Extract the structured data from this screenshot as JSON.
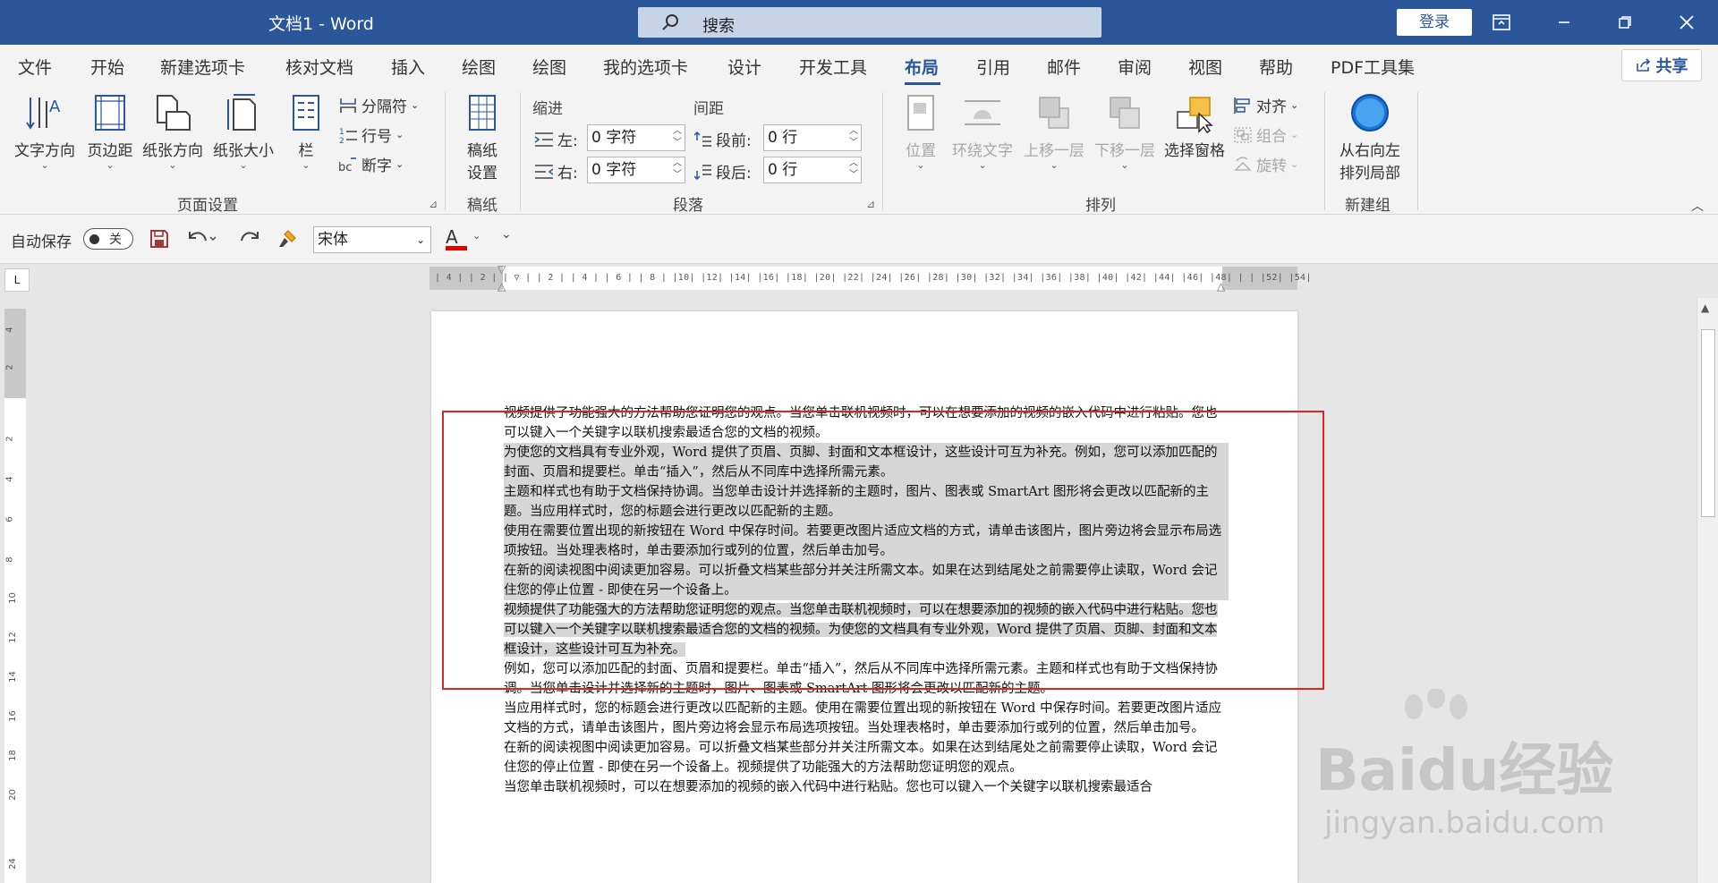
{
  "window": {
    "title": "文档1  -  Word"
  },
  "search": {
    "placeholder": "搜索"
  },
  "account": {
    "login_label": "登录"
  },
  "tabs": [
    "文件",
    "开始",
    "新建选项卡",
    "核对文档",
    "插入",
    "绘图",
    "绘图",
    "我的选项卡",
    "设计",
    "开发工具",
    "布局",
    "引用",
    "邮件",
    "审阅",
    "视图",
    "帮助",
    "PDF工具集"
  ],
  "active_tab": "布局",
  "share": {
    "label": "共享"
  },
  "ribbon": {
    "page_setup": {
      "text_direction": "文字方向",
      "margins": "页边距",
      "orientation": "纸张方向",
      "size": "纸张大小",
      "columns": "栏",
      "breaks": "分隔符",
      "line_numbers": "行号",
      "hyphenation": "断字",
      "group_label": "页面设置"
    },
    "manuscript": {
      "button": "稿纸\n设置",
      "btn_line1": "稿纸",
      "btn_line2": "设置",
      "group_label": "稿纸"
    },
    "paragraph": {
      "indent_title": "缩进",
      "spacing_title": "间距",
      "left_label": "左:",
      "left_value": "0 字符",
      "right_label": "右:",
      "right_value": "0 字符",
      "before_label": "段前:",
      "before_value": "0 行",
      "after_label": "段后:",
      "after_value": "0 行",
      "group_label": "段落"
    },
    "arrange": {
      "position": "位置",
      "wrap_text": "环绕文字",
      "bring_forward": "上移一层",
      "send_backward": "下移一层",
      "selection_pane": "选择窗格",
      "align": "对齐",
      "group": "组合",
      "rotate": "旋转",
      "group_label": "排列"
    },
    "new_group": {
      "btn_line1": "从右向左",
      "btn_line2": "排列局部",
      "group_label": "新建组"
    }
  },
  "qat": {
    "autosave_label": "自动保存",
    "autosave_state": "关",
    "font_name": "宋体",
    "font_color_letter": "A"
  },
  "ruler": {
    "ticks": "| 4 |  | 2 |  | ▽ |  | 2 |  | 4 |  | 6 |  | 8 |  |10|  |12|  |14|  |16|  |18|  |20|  |22|  |24|  |26|  |28|  |30|  |32|  |34|  |36|  |38|  |40|  |42|  |44|  |46|  |48|  |  |  |52|  |54|",
    "vertical": [
      "4",
      "2",
      "",
      "2",
      "4",
      "6",
      "8",
      "10",
      "12",
      "14",
      "16",
      "18",
      "20",
      "24"
    ],
    "corner": "L"
  },
  "document": {
    "paragraphs": [
      {
        "text": "视频提供了功能强大的方法帮助您证明您的观点。当您单击联机视频时，可以在想要添加的视频的嵌入代码中进行粘贴。您也可以键入一个关键字以联机搜索最适合您的文档的视频。",
        "selected": false
      },
      {
        "text": "为使您的文档具有专业外观，Word 提供了页眉、页脚、封面和文本框设计，这些设计可互为补充。例如，您可以添加匹配的封面、页眉和提要栏。单击“插入”，然后从不同库中选择所需元素。",
        "selected": true
      },
      {
        "text": "主题和样式也有助于文档保持协调。当您单击设计并选择新的主题时，图片、图表或 SmartArt 图形将会更改以匹配新的主题。当应用样式时，您的标题会进行更改以匹配新的主题。",
        "selected": true
      },
      {
        "text": "使用在需要位置出现的新按钮在 Word 中保存时间。若要更改图片适应文档的方式，请单击该图片，图片旁边将会显示布局选项按钮。当处理表格时，单击要添加行或列的位置，然后单击加号。",
        "selected": true
      },
      {
        "text": "在新的阅读视图中阅读更加容易。可以折叠文档某些部分并关注所需文本。如果在达到结尾处之前需要停止读取，Word 会记住您的停止位置 - 即使在另一个设备上。",
        "selected": true
      },
      {
        "text": "视频提供了功能强大的方法帮助您证明您的观点。当您单击联机视频时，可以在想要添加的视频的嵌入代码中进行粘贴。您也可以键入一个关键字以联机搜索最适合您的文档的视频。为使您的文档具有专业外观，Word 提供了页眉、页脚、封面和文本框设计，这些设计可互为补充。",
        "selected": false
      },
      {
        "text": "例如，您可以添加匹配的封面、页眉和提要栏。单击“插入”，然后从不同库中选择所需元素。主题和样式也有助于文档保持协调。当您单击设计并选择新的主题时，图片、图表或 SmartArt 图形将会更改以匹配新的主题。",
        "selected": false
      },
      {
        "text": "当应用样式时，您的标题会进行更改以匹配新的主题。使用在需要位置出现的新按钮在 Word 中保存时间。若要更改图片适应文档的方式，请单击该图片，图片旁边将会显示布局选项按钮。当处理表格时，单击要添加行或列的位置，然后单击加号。",
        "selected": false
      },
      {
        "text": "在新的阅读视图中阅读更加容易。可以折叠文档某些部分并关注所需文本。如果在达到结尾处之前需要停止读取，Word 会记住您的停止位置 - 即使在另一个设备上。视频提供了功能强大的方法帮助您证明您的观点。",
        "selected": false
      },
      {
        "text": "当您单击联机视频时，可以在想要添加的视频的嵌入代码中进行粘贴。您也可以键入一个关键字以联机搜索最适合",
        "selected": false
      }
    ]
  },
  "watermark": {
    "brand": "Baidu经验",
    "url": "jingyan.baidu.com"
  },
  "colors": {
    "title_bar": "#2b579a",
    "accent": "#2b579a",
    "selection_box": "#e02424",
    "selected_text_bg": "#d6d6d6"
  }
}
